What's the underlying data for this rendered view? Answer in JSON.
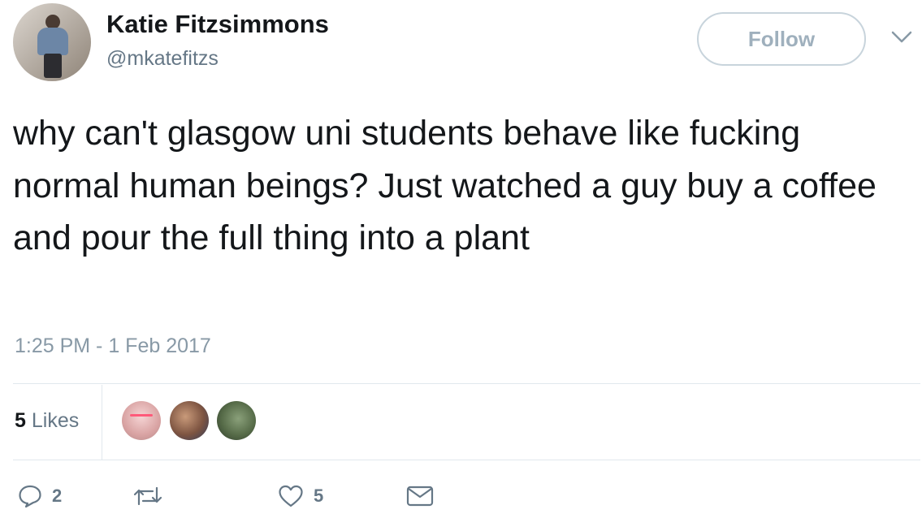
{
  "user": {
    "display_name": "Katie Fitzsimmons",
    "handle": "@mkatefitzs",
    "avatar_icon": "profile-photo"
  },
  "follow_button": {
    "label": "Follow"
  },
  "more_menu": {
    "icon": "chevron-down-icon"
  },
  "tweet": {
    "text": "why can't glasgow uni students behave like fucking normal human beings? Just watched a guy buy a coffee and pour the full thing into a plant",
    "timestamp": "1:25 PM - 1 Feb 2017"
  },
  "stats": {
    "likes_count": "5",
    "likes_label": "Likes"
  },
  "actions": {
    "reply_count": "2",
    "retweet_count": "",
    "like_count": "5"
  },
  "colors": {
    "text_primary": "#14171a",
    "text_secondary": "#657786",
    "border": "#e1e8ed",
    "follow_text": "#9fb0bd"
  }
}
